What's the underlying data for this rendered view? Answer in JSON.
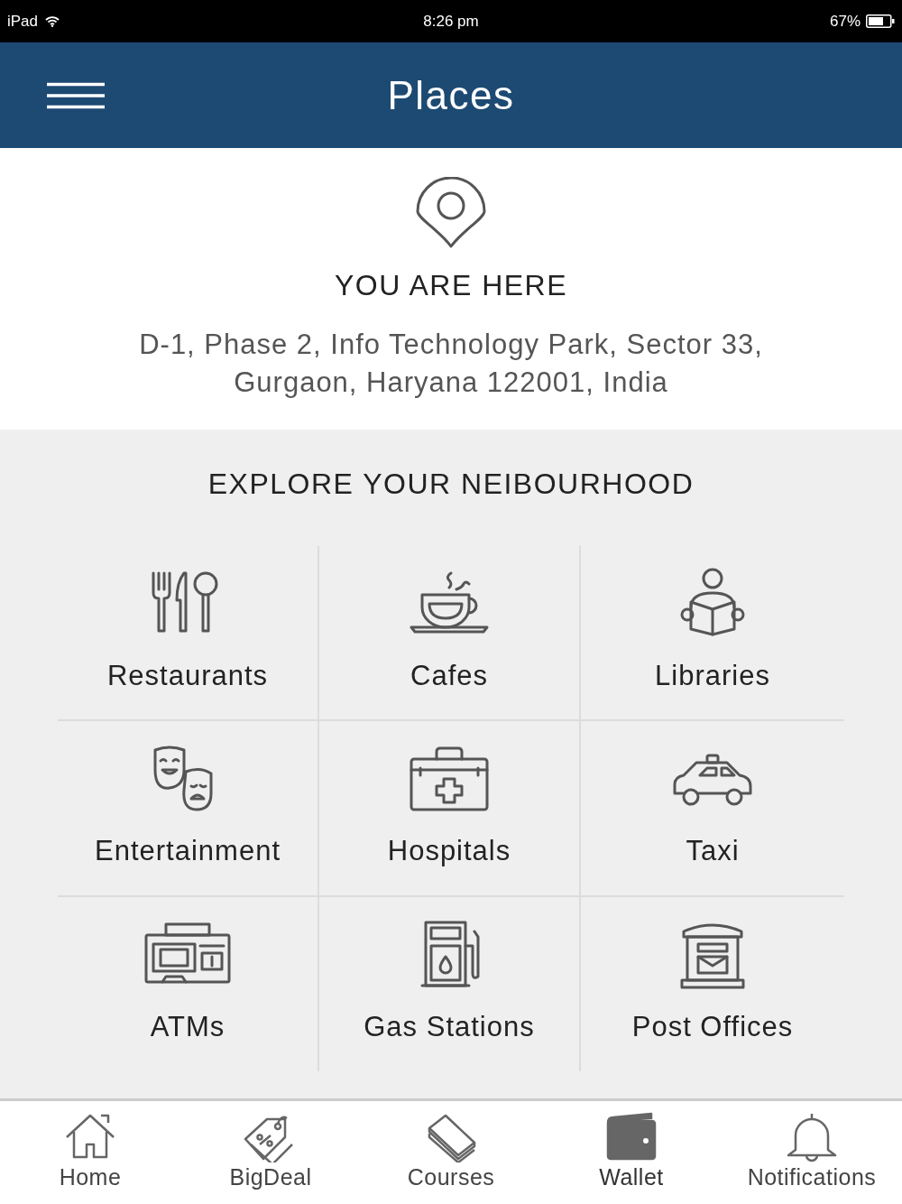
{
  "status_bar": {
    "device": "iPad",
    "time": "8:26 pm",
    "battery": "67%"
  },
  "header": {
    "title": "Places"
  },
  "location": {
    "heading": "YOU ARE HERE",
    "address": "D-1, Phase 2, Info Technology Park, Sector 33, Gurgaon, Haryana 122001, India"
  },
  "explore": {
    "heading": "EXPLORE YOUR NEIBOURHOOD",
    "places": [
      {
        "kind": "restaurant",
        "label": "Restaurants"
      },
      {
        "kind": "cafe",
        "label": "Cafes"
      },
      {
        "kind": "library",
        "label": "Libraries"
      },
      {
        "kind": "entertainment",
        "label": "Entertainment"
      },
      {
        "kind": "hospital",
        "label": "Hospitals"
      },
      {
        "kind": "taxi",
        "label": "Taxi"
      },
      {
        "kind": "atm",
        "label": "ATMs"
      },
      {
        "kind": "gas",
        "label": "Gas Stations"
      },
      {
        "kind": "post",
        "label": "Post Offices"
      }
    ]
  },
  "tab_bar": [
    {
      "kind": "home",
      "label": "Home",
      "selected": false
    },
    {
      "kind": "deal",
      "label": "BigDeal",
      "selected": false
    },
    {
      "kind": "courses",
      "label": "Courses",
      "selected": false
    },
    {
      "kind": "wallet",
      "label": "Wallet",
      "selected": true
    },
    {
      "kind": "bell",
      "label": "Notifications",
      "selected": false
    }
  ]
}
